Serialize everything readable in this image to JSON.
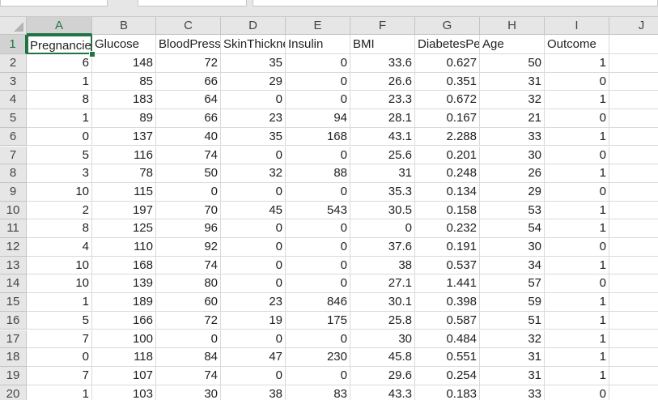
{
  "spreadsheet": {
    "columns": [
      "A",
      "B",
      "C",
      "D",
      "E",
      "F",
      "G",
      "H",
      "I",
      "J"
    ],
    "active_cell": "A1",
    "headers": [
      "Pregnancies",
      "Glucose",
      "BloodPressure",
      "SkinThickness",
      "Insulin",
      "BMI",
      "DiabetesPedigreeFunction",
      "Age",
      "Outcome"
    ],
    "rows": [
      {
        "num": "1",
        "cells": []
      },
      {
        "num": "2",
        "cells": [
          "6",
          "148",
          "72",
          "35",
          "0",
          "33.6",
          "0.627",
          "50",
          "1"
        ]
      },
      {
        "num": "3",
        "cells": [
          "1",
          "85",
          "66",
          "29",
          "0",
          "26.6",
          "0.351",
          "31",
          "0"
        ]
      },
      {
        "num": "4",
        "cells": [
          "8",
          "183",
          "64",
          "0",
          "0",
          "23.3",
          "0.672",
          "32",
          "1"
        ]
      },
      {
        "num": "5",
        "cells": [
          "1",
          "89",
          "66",
          "23",
          "94",
          "28.1",
          "0.167",
          "21",
          "0"
        ]
      },
      {
        "num": "6",
        "cells": [
          "0",
          "137",
          "40",
          "35",
          "168",
          "43.1",
          "2.288",
          "33",
          "1"
        ]
      },
      {
        "num": "7",
        "cells": [
          "5",
          "116",
          "74",
          "0",
          "0",
          "25.6",
          "0.201",
          "30",
          "0"
        ]
      },
      {
        "num": "8",
        "cells": [
          "3",
          "78",
          "50",
          "32",
          "88",
          "31",
          "0.248",
          "26",
          "1"
        ]
      },
      {
        "num": "9",
        "cells": [
          "10",
          "115",
          "0",
          "0",
          "0",
          "35.3",
          "0.134",
          "29",
          "0"
        ]
      },
      {
        "num": "10",
        "cells": [
          "2",
          "197",
          "70",
          "45",
          "543",
          "30.5",
          "0.158",
          "53",
          "1"
        ]
      },
      {
        "num": "11",
        "cells": [
          "8",
          "125",
          "96",
          "0",
          "0",
          "0",
          "0.232",
          "54",
          "1"
        ]
      },
      {
        "num": "12",
        "cells": [
          "4",
          "110",
          "92",
          "0",
          "0",
          "37.6",
          "0.191",
          "30",
          "0"
        ]
      },
      {
        "num": "13",
        "cells": [
          "10",
          "168",
          "74",
          "0",
          "0",
          "38",
          "0.537",
          "34",
          "1"
        ]
      },
      {
        "num": "14",
        "cells": [
          "10",
          "139",
          "80",
          "0",
          "0",
          "27.1",
          "1.441",
          "57",
          "0"
        ]
      },
      {
        "num": "15",
        "cells": [
          "1",
          "189",
          "60",
          "23",
          "846",
          "30.1",
          "0.398",
          "59",
          "1"
        ]
      },
      {
        "num": "16",
        "cells": [
          "5",
          "166",
          "72",
          "19",
          "175",
          "25.8",
          "0.587",
          "51",
          "1"
        ]
      },
      {
        "num": "17",
        "cells": [
          "7",
          "100",
          "0",
          "0",
          "0",
          "30",
          "0.484",
          "32",
          "1"
        ]
      },
      {
        "num": "18",
        "cells": [
          "0",
          "118",
          "84",
          "47",
          "230",
          "45.8",
          "0.551",
          "31",
          "1"
        ]
      },
      {
        "num": "19",
        "cells": [
          "7",
          "107",
          "74",
          "0",
          "0",
          "29.6",
          "0.254",
          "31",
          "1"
        ]
      },
      {
        "num": "20",
        "cells": [
          "1",
          "103",
          "30",
          "38",
          "83",
          "43.3",
          "0.183",
          "33",
          "0"
        ]
      }
    ]
  }
}
